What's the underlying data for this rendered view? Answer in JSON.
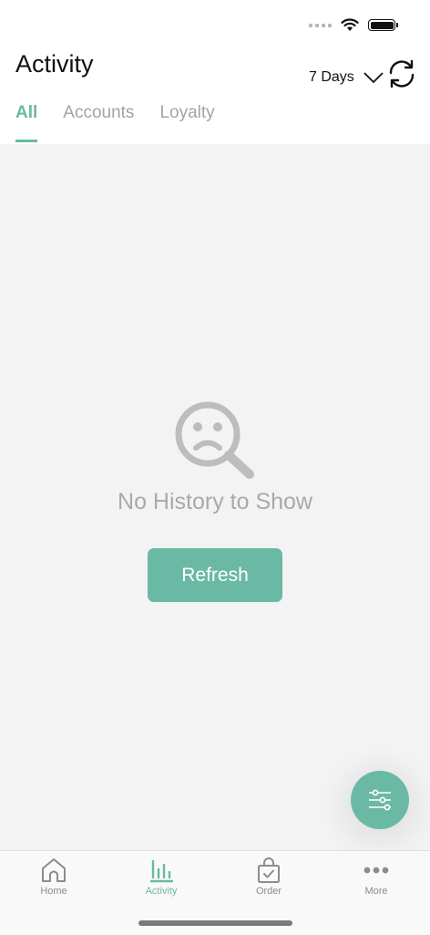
{
  "header": {
    "title": "Activity",
    "range_label": "7 Days"
  },
  "tabs": [
    {
      "label": "All"
    },
    {
      "label": "Accounts"
    },
    {
      "label": "Loyalty"
    }
  ],
  "empty_state": {
    "message": "No History to Show",
    "button_label": "Refresh"
  },
  "tabbar": {
    "items": [
      {
        "label": "Home",
        "icon": "home-icon"
      },
      {
        "label": "Activity",
        "icon": "bar-chart-icon"
      },
      {
        "label": "Order",
        "icon": "shopping-bag-icon"
      },
      {
        "label": "More",
        "icon": "more-dots-icon"
      }
    ]
  },
  "colors": {
    "accent": "#69b9a4",
    "background": "#f3f3f3",
    "muted_text": "#a9a9a9"
  }
}
